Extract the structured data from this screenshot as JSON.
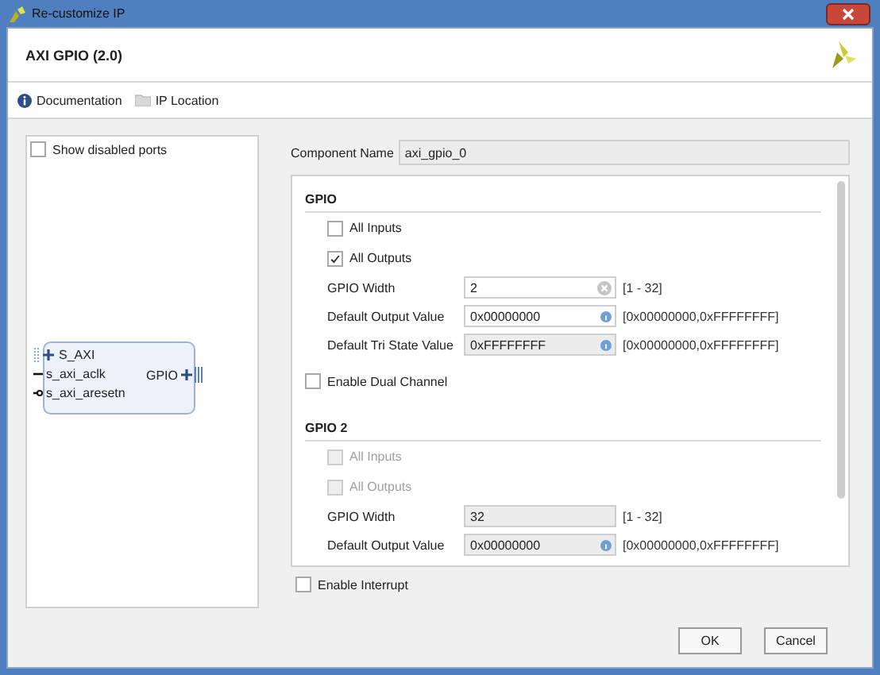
{
  "window": {
    "title": "Re-customize IP"
  },
  "header": {
    "title": "AXI GPIO (2.0)"
  },
  "toolbar": [
    {
      "kind": "info",
      "label": "Documentation"
    },
    {
      "kind": "folder",
      "label": "IP Location"
    }
  ],
  "left_panel": {
    "show_disabled_ports": {
      "label": "Show disabled ports",
      "checked": false
    },
    "block": {
      "inputs": [
        {
          "kind": "bus",
          "label": "S_AXI"
        },
        {
          "kind": "clock",
          "label": "s_axi_aclk"
        },
        {
          "kind": "resetn",
          "label": "s_axi_aresetn"
        }
      ],
      "outputs": [
        {
          "kind": "bus",
          "label": "GPIO"
        }
      ]
    }
  },
  "component_name": {
    "label": "Component Name",
    "value": "axi_gpio_0"
  },
  "sections": [
    {
      "title": "GPIO",
      "rows": [
        {
          "kind": "checkbox",
          "label": "All Inputs",
          "checked": false,
          "disabled": false
        },
        {
          "kind": "checkbox",
          "label": "All Outputs",
          "checked": true,
          "disabled": false
        },
        {
          "kind": "clearfield",
          "label": "GPIO Width",
          "value": "2",
          "range": "[1 - 32]",
          "disabled": false
        },
        {
          "kind": "infofield",
          "label": "Default Output Value",
          "value": "0x00000000",
          "range": "[0x00000000,0xFFFFFFFF]",
          "disabled": false
        },
        {
          "kind": "infofield",
          "label": "Default Tri State Value",
          "value": "0xFFFFFFFF",
          "range": "[0x00000000,0xFFFFFFFF]",
          "disabled": true
        },
        {
          "kind": "option",
          "label": "Enable Dual Channel",
          "checked": false,
          "disabled": false
        }
      ]
    },
    {
      "title": "GPIO 2",
      "rows": [
        {
          "kind": "checkbox",
          "label": "All Inputs",
          "checked": false,
          "disabled": true
        },
        {
          "kind": "checkbox",
          "label": "All Outputs",
          "checked": false,
          "disabled": true
        },
        {
          "kind": "field",
          "label": "GPIO Width",
          "value": "32",
          "range": "[1 - 32]",
          "disabled": true
        },
        {
          "kind": "infofield",
          "label": "Default Output Value",
          "value": "0x00000000",
          "range": "[0x00000000,0xFFFFFFFF]",
          "disabled": true
        }
      ]
    }
  ],
  "enable_interrupt": {
    "label": "Enable Interrupt",
    "checked": false
  },
  "buttons": [
    "OK",
    "Cancel"
  ]
}
